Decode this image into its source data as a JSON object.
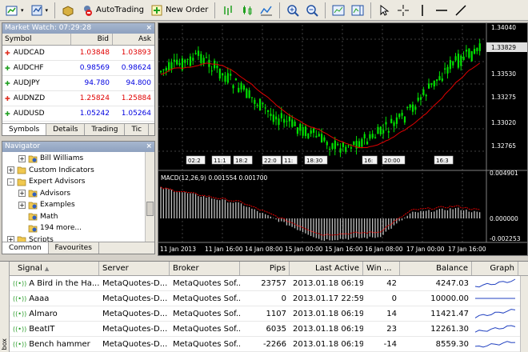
{
  "toolbar": {
    "autotrading_label": "AutoTrading",
    "new_order_label": "New Order"
  },
  "market_watch": {
    "title": "Market Watch: 07:29:28",
    "columns": [
      "Symbol",
      "Bid",
      "Ask"
    ],
    "rows": [
      {
        "symbol": "AUDCAD",
        "bid": "1.03848",
        "ask": "1.03893",
        "dir": "down",
        "color": "#e00000"
      },
      {
        "symbol": "AUDCHF",
        "bid": "0.98569",
        "ask": "0.98624",
        "dir": "up",
        "color": "#0000e0"
      },
      {
        "symbol": "AUDJPY",
        "bid": "94.780",
        "ask": "94.800",
        "dir": "up",
        "color": "#0000e0"
      },
      {
        "symbol": "AUDNZD",
        "bid": "1.25824",
        "ask": "1.25884",
        "dir": "down",
        "color": "#e00000"
      },
      {
        "symbol": "AUDUSD",
        "bid": "1.05242",
        "ask": "1.05264",
        "dir": "up",
        "color": "#0000e0"
      }
    ],
    "tabs": [
      "Symbols",
      "Details",
      "Trading",
      "Tic"
    ]
  },
  "navigator": {
    "title": "Navigator",
    "items": [
      {
        "label": "Bill Williams",
        "indent": 1,
        "toggle": "+"
      },
      {
        "label": "Custom Indicators",
        "indent": 0,
        "toggle": "+"
      },
      {
        "label": "Expert Advisors",
        "indent": 0,
        "toggle": "-"
      },
      {
        "label": "Advisors",
        "indent": 1,
        "toggle": "+"
      },
      {
        "label": "Examples",
        "indent": 1,
        "toggle": "+"
      },
      {
        "label": "Math",
        "indent": 1,
        "toggle": ""
      },
      {
        "label": "194 more...",
        "indent": 1,
        "toggle": ""
      },
      {
        "label": "Scripts",
        "indent": 0,
        "toggle": "+"
      }
    ],
    "tabs": [
      "Common",
      "Favourites"
    ]
  },
  "chart": {
    "price_ticks": [
      "1.34040",
      "1.33829",
      "1.33530",
      "1.33275",
      "1.33020",
      "1.32765"
    ],
    "current_price": "1.33829",
    "macd_label": "MACD(12,26,9) 0.001554 0.001700",
    "macd_ticks": [
      "0.004901",
      "0.000000",
      "-0.002253"
    ],
    "time_ticks": [
      "11 Jan 2013",
      "11 Jan 16:00",
      "14 Jan 08:00",
      "15 Jan 00:00",
      "15 Jan 16:00",
      "16 Jan 08:00",
      "17 Jan 00:00",
      "17 Jan 16:00"
    ],
    "event_labels": [
      "02:2",
      "11:1",
      "18:2",
      "22:0",
      "11:",
      "18:30",
      "16:",
      "20:00",
      "16:3"
    ],
    "colors": {
      "candle": "#00e000",
      "ma": "#e00000",
      "macd_hist": "#c0c0c0",
      "signal": "#e00000",
      "grid": "#404040"
    }
  },
  "signals": {
    "side_label": "box",
    "columns": [
      "Signal",
      "Server",
      "Broker",
      "Pips",
      "Last Active",
      "Win ...",
      "Balance",
      "Graph"
    ],
    "rows": [
      {
        "signal": "A Bird in the Ha...",
        "server": "MetaQuotes-D...",
        "broker": "MetaQuotes Sof...",
        "pips": "23757",
        "last_active": "2013.01.18 06:19",
        "win": "42",
        "balance": "4247.03"
      },
      {
        "signal": "Aaaa",
        "server": "MetaQuotes-D...",
        "broker": "MetaQuotes Sof...",
        "pips": "0",
        "last_active": "2013.01.17 22:59",
        "win": "0",
        "balance": "10000.00"
      },
      {
        "signal": "Almaro",
        "server": "MetaQuotes-D...",
        "broker": "MetaQuotes Sof...",
        "pips": "1107",
        "last_active": "2013.01.18 06:19",
        "win": "14",
        "balance": "11421.47"
      },
      {
        "signal": "BeatIT",
        "server": "MetaQuotes-D...",
        "broker": "MetaQuotes Sof...",
        "pips": "6035",
        "last_active": "2013.01.18 06:19",
        "win": "23",
        "balance": "12261.30"
      },
      {
        "signal": "Bench hammer",
        "server": "MetaQuotes-D...",
        "broker": "MetaQuotes Sof...",
        "pips": "-2266",
        "last_active": "2013.01.18 06:19",
        "win": "-14",
        "balance": "8559.30"
      }
    ]
  }
}
